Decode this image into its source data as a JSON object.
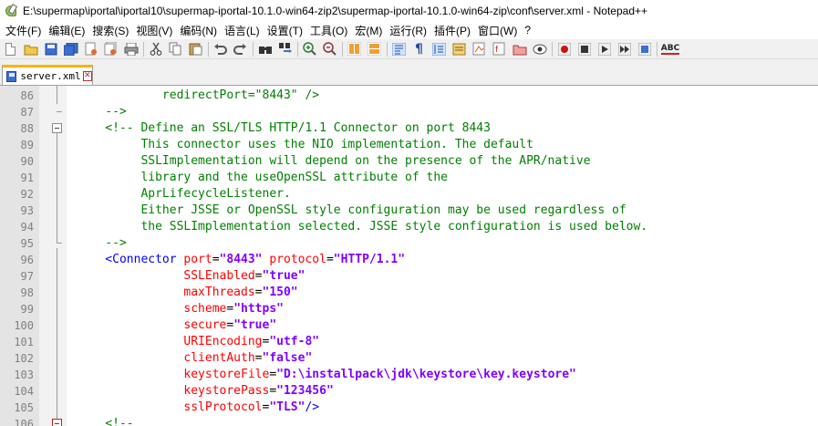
{
  "window": {
    "title": "E:\\supermap\\iportal\\iportal10\\supermap-iportal-10.1.0-win64-zip2\\supermap-iportal-10.1.0-win64-zip\\conf\\server.xml - Notepad++"
  },
  "menu": [
    {
      "label": "文件(F)"
    },
    {
      "label": "编辑(E)"
    },
    {
      "label": "搜索(S)"
    },
    {
      "label": "视图(V)"
    },
    {
      "label": "编码(N)"
    },
    {
      "label": "语言(L)"
    },
    {
      "label": "设置(T)"
    },
    {
      "label": "工具(O)"
    },
    {
      "label": "宏(M)"
    },
    {
      "label": "运行(R)"
    },
    {
      "label": "插件(P)"
    },
    {
      "label": "窗口(W)"
    },
    {
      "label": "?"
    }
  ],
  "toolbar": {
    "spell_label": "ABC"
  },
  "tab": {
    "label": "server.xml"
  },
  "editor": {
    "lines": [
      {
        "num": "86",
        "segments": [
          {
            "t": "            redirectPort=\"8443\" />",
            "c": "c-comment"
          }
        ]
      },
      {
        "num": "87",
        "segments": [
          {
            "t": "    -->",
            "c": "c-comment"
          }
        ]
      },
      {
        "num": "88",
        "segments": [
          {
            "t": "    <!-- Define an SSL/TLS HTTP/1.1 Connector on port 8443",
            "c": "c-comment"
          }
        ]
      },
      {
        "num": "89",
        "segments": [
          {
            "t": "         This connector uses the NIO implementation. The default",
            "c": "c-comment"
          }
        ]
      },
      {
        "num": "90",
        "segments": [
          {
            "t": "         SSLImplementation will depend on the presence of the APR/native",
            "c": "c-comment"
          }
        ]
      },
      {
        "num": "91",
        "segments": [
          {
            "t": "         library and the useOpenSSL attribute of the",
            "c": "c-comment"
          }
        ]
      },
      {
        "num": "92",
        "segments": [
          {
            "t": "         AprLifecycleListener.",
            "c": "c-comment"
          }
        ]
      },
      {
        "num": "93",
        "segments": [
          {
            "t": "         Either JSSE or OpenSSL style configuration may be used regardless of",
            "c": "c-comment"
          }
        ]
      },
      {
        "num": "94",
        "segments": [
          {
            "t": "         the SSLImplementation selected. JSSE style configuration is used below.",
            "c": "c-comment"
          }
        ]
      },
      {
        "num": "95",
        "segments": [
          {
            "t": "    -->",
            "c": "c-comment"
          }
        ]
      },
      {
        "num": "96",
        "segments": [
          {
            "t": "    <Connector ",
            "c": "c-tag"
          },
          {
            "t": "port",
            "c": "c-attr"
          },
          {
            "t": "=",
            "c": "c-eq"
          },
          {
            "t": "\"8443\"",
            "c": "c-val"
          },
          {
            "t": " protocol",
            "c": "c-attr"
          },
          {
            "t": "=",
            "c": "c-eq"
          },
          {
            "t": "\"HTTP/1.1\"",
            "c": "c-val"
          }
        ]
      },
      {
        "num": "97",
        "segments": [
          {
            "t": "               SSLEnabled",
            "c": "c-attr"
          },
          {
            "t": "=",
            "c": "c-eq"
          },
          {
            "t": "\"true\"",
            "c": "c-val"
          }
        ]
      },
      {
        "num": "98",
        "segments": [
          {
            "t": "               maxThreads",
            "c": "c-attr"
          },
          {
            "t": "=",
            "c": "c-eq"
          },
          {
            "t": "\"150\"",
            "c": "c-val"
          }
        ]
      },
      {
        "num": "99",
        "segments": [
          {
            "t": "               scheme",
            "c": "c-attr"
          },
          {
            "t": "=",
            "c": "c-eq"
          },
          {
            "t": "\"https\"",
            "c": "c-val"
          }
        ]
      },
      {
        "num": "100",
        "segments": [
          {
            "t": "               secure",
            "c": "c-attr"
          },
          {
            "t": "=",
            "c": "c-eq"
          },
          {
            "t": "\"true\"",
            "c": "c-val"
          }
        ]
      },
      {
        "num": "101",
        "segments": [
          {
            "t": "               URIEncoding",
            "c": "c-attr"
          },
          {
            "t": "=",
            "c": "c-eq"
          },
          {
            "t": "\"utf-8\"",
            "c": "c-val"
          }
        ]
      },
      {
        "num": "102",
        "segments": [
          {
            "t": "               clientAuth",
            "c": "c-attr"
          },
          {
            "t": "=",
            "c": "c-eq"
          },
          {
            "t": "\"false\"",
            "c": "c-val"
          }
        ]
      },
      {
        "num": "103",
        "segments": [
          {
            "t": "               keystoreFile",
            "c": "c-attr"
          },
          {
            "t": "=",
            "c": "c-eq"
          },
          {
            "t": "\"D:\\installpack\\jdk\\keystore\\key.keystore\"",
            "c": "c-val"
          }
        ]
      },
      {
        "num": "104",
        "segments": [
          {
            "t": "               keystorePass",
            "c": "c-attr"
          },
          {
            "t": "=",
            "c": "c-eq"
          },
          {
            "t": "\"123456\"",
            "c": "c-val"
          }
        ]
      },
      {
        "num": "105",
        "segments": [
          {
            "t": "               sslProtocol",
            "c": "c-attr"
          },
          {
            "t": "=",
            "c": "c-eq"
          },
          {
            "t": "\"TLS\"",
            "c": "c-val"
          },
          {
            "t": "/>",
            "c": "c-tag"
          }
        ]
      },
      {
        "num": "106",
        "segments": [
          {
            "t": "    <!--",
            "c": "c-comment"
          }
        ]
      }
    ]
  },
  "colors": {
    "comment": "#008000",
    "tag": "#0000ff",
    "attribute": "#ff0000",
    "value": "#8000ff",
    "tab_accent": "#fab400"
  }
}
